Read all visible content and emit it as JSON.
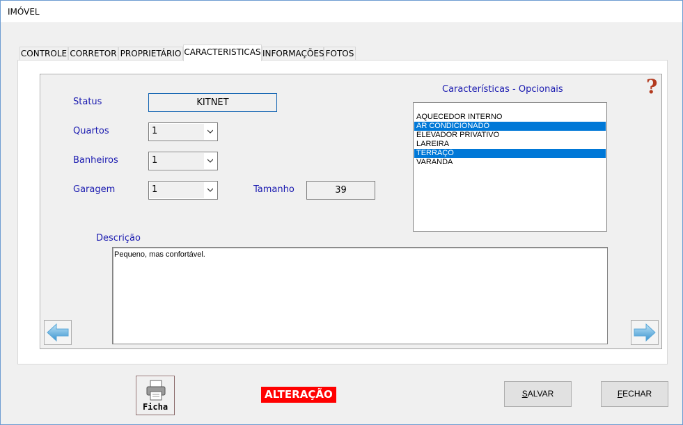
{
  "window": {
    "title": "IMÓVEL"
  },
  "tabs": [
    {
      "label": "CONTROLE"
    },
    {
      "label": "CORRETOR"
    },
    {
      "label": "PROPRIETÁRIO"
    },
    {
      "label": "CARACTERISTICAS",
      "active": true
    },
    {
      "label": "INFORMAÇÕES"
    },
    {
      "label": "FOTOS"
    }
  ],
  "form": {
    "status_label": "Status",
    "status_value": "KITNET",
    "quartos_label": "Quartos",
    "quartos_value": "1",
    "banheiros_label": "Banheiros",
    "banheiros_value": "1",
    "garagem_label": "Garagem",
    "garagem_value": "1",
    "tamanho_label": "Tamanho",
    "tamanho_value": "39",
    "descricao_label": "Descrição",
    "descricao_value": "Pequeno, mas confortável."
  },
  "caracteristicas": {
    "title": "Características  -  Opcionais",
    "items": [
      {
        "label": "AQUECEDOR INTERNO",
        "selected": false
      },
      {
        "label": "AR CONDICIONADO",
        "selected": true
      },
      {
        "label": "ELEVADOR PRIVATIVO",
        "selected": false
      },
      {
        "label": "LAREIRA",
        "selected": false
      },
      {
        "label": "TERRAÇO",
        "selected": true
      },
      {
        "label": "VARANDA",
        "selected": false
      }
    ]
  },
  "help": {
    "glyph": "?"
  },
  "footer": {
    "ficha_label": "Ficha",
    "mode_label": "ALTERAÇÃO",
    "save_label": "SALVAR",
    "save_key": "S",
    "save_rest": "ALVAR",
    "close_label": "FECHAR",
    "close_key": "F",
    "close_rest": "ECHAR"
  },
  "colors": {
    "label_blue": "#1a1ab0",
    "selection": "#0078d7",
    "mode_badge": "#ff0000",
    "help_icon": "#b33a1e"
  },
  "icons": {
    "prev": "arrow-left-icon",
    "next": "arrow-right-icon",
    "help": "question-mark-icon",
    "ficha": "printer-icon"
  }
}
